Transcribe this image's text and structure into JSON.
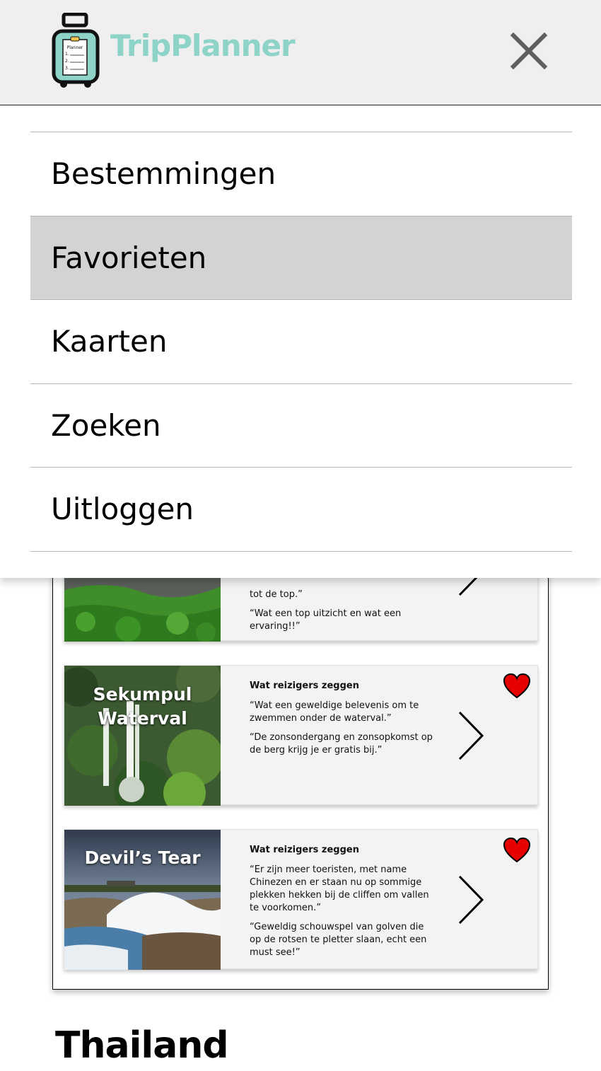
{
  "app": {
    "name": "TripPlanner",
    "logo_text": "Planner",
    "logo_list": [
      "1.",
      "2.",
      "3."
    ]
  },
  "menu": {
    "items": [
      {
        "label": "Bestemmingen",
        "active": false
      },
      {
        "label": "Favorieten",
        "active": true
      },
      {
        "label": "Kaarten",
        "active": false
      },
      {
        "label": "Zoeken",
        "active": false
      },
      {
        "label": "Uitloggen",
        "active": false
      }
    ]
  },
  "cards": {
    "partial": {
      "quotes": [
        "tot de top.”",
        "“Wat een top uitzicht en wat een ervaring!!”"
      ]
    },
    "sekumpul": {
      "title_line1": "Sekumpul",
      "title_line2": "Waterval",
      "heading": "Wat reizigers zeggen",
      "quotes": [
        "“Wat een geweldige belevenis om te zwemmen onder de waterval.”",
        "“De zonsondergang en zonsopkomst op de berg krijg je er gratis bij.”"
      ]
    },
    "devils_tear": {
      "title": "Devil’s Tear",
      "heading": "Wat reizigers zeggen",
      "quotes": [
        "“Er zijn meer toeristen, met name Chinezen en er staan nu op sommige plekken hekken bij de cliffen om vallen te voorkomen.”",
        "“Geweldig schouwspel van golven die op de rotsen te pletter slaan, echt een must see!”"
      ]
    }
  },
  "section": {
    "title": "Thailand"
  },
  "colors": {
    "brand": "#8dd3c7",
    "active_menu": "#d3d3d3",
    "heart": "#e60000"
  },
  "icons": {
    "close": "close-icon",
    "heart": "heart-icon",
    "chevron": "chevron-right-icon",
    "logo": "suitcase-icon"
  }
}
